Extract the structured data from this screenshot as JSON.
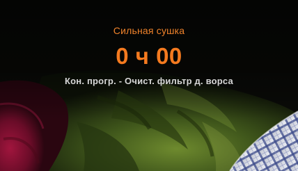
{
  "display": {
    "program_name": "Сильная сушка",
    "remaining_time": "0 ч 00",
    "status_message": "Кон. прогр. - Очист. фильтр д. ворса"
  },
  "colors": {
    "accent_orange": "#f47a1f",
    "status_text": "#d7d7d7",
    "background_dark": "#0a0b08",
    "towel_red": "#8c1233",
    "cloth_green": "#4f6a22",
    "plaid_white": "#d9dbe3"
  }
}
